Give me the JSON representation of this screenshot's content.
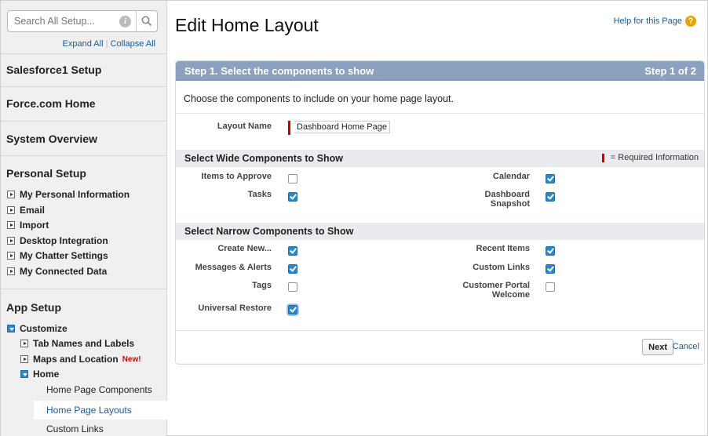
{
  "sidebar": {
    "search_placeholder": "Search All Setup...",
    "expand_all": "Expand All",
    "collapse_all": "Collapse All",
    "sections": {
      "s1": "Salesforce1 Setup",
      "force": "Force.com Home",
      "overview": "System Overview",
      "personal": "Personal Setup",
      "app": "App Setup"
    },
    "personal_items": {
      "i0": "My Personal Information",
      "i1": "Email",
      "i2": "Import",
      "i3": "Desktop Integration",
      "i4": "My Chatter Settings",
      "i5": "My Connected Data"
    },
    "app_items": {
      "customize": "Customize",
      "tabs": "Tab Names and Labels",
      "maps": "Maps and Location",
      "maps_badge": "New!",
      "home": "Home",
      "hpc": "Home Page Components",
      "hpl": "Home Page Layouts",
      "links": "Custom Links"
    }
  },
  "main": {
    "title": "Edit Home Layout",
    "help": "Help for this Page",
    "step_title": "Step 1. Select the components to show",
    "step_count": "Step 1 of 2",
    "intro": "Choose the components to include on your home page layout.",
    "layout_name_label": "Layout Name",
    "layout_name_value": "Dashboard Home Page",
    "wide_title": "Select Wide Components to Show",
    "required_info": "= Required Information",
    "narrow_title": "Select Narrow Components to Show",
    "wide": {
      "items_to_approve": {
        "label": "Items to Approve",
        "checked": false
      },
      "calendar": {
        "label": "Calendar",
        "checked": true
      },
      "tasks": {
        "label": "Tasks",
        "checked": true
      },
      "dash1": "Dashboard",
      "dash2": "Snapshot",
      "dashboard_checked": true
    },
    "narrow": {
      "create_new": {
        "label": "Create New...",
        "checked": true
      },
      "recent_items": {
        "label": "Recent Items",
        "checked": true
      },
      "messages": {
        "label": "Messages & Alerts",
        "checked": true
      },
      "custom_links": {
        "label": "Custom Links",
        "checked": true
      },
      "tags": {
        "label": "Tags",
        "checked": false
      },
      "cp1": "Customer Portal",
      "cp2": "Welcome",
      "customer_portal_checked": false,
      "universal_restore": {
        "label": "Universal Restore",
        "checked": true
      }
    },
    "next": "Next",
    "cancel": "Cancel"
  },
  "colors": {
    "step_header": "#8ca0c0",
    "link": "#1a5b9e",
    "checkbox": "#2a87c8",
    "required": "#cc0000"
  }
}
